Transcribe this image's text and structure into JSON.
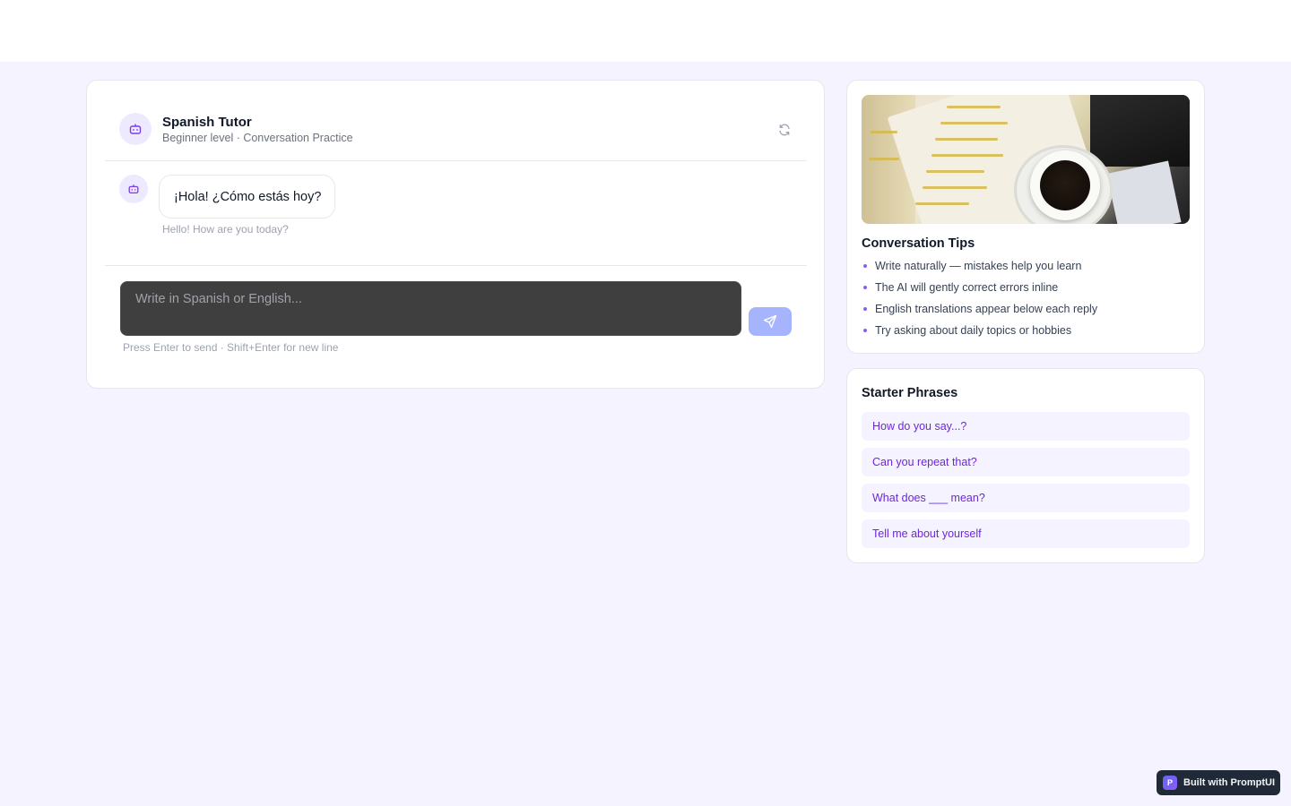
{
  "chat": {
    "tutor_name": "Spanish Tutor",
    "tutor_subtitle": "Beginner level · Conversation Practice",
    "messages": [
      {
        "role": "tutor",
        "text": "¡Hola! ¿Cómo estás hoy?",
        "translation": "Hello! How are you today?"
      }
    ],
    "input": {
      "placeholder": "Write in Spanish or English...",
      "value": ""
    },
    "hint": "Press Enter to send · Shift+Enter for new line"
  },
  "tips": {
    "title": "Conversation Tips",
    "items": [
      "Write naturally — mistakes help you learn",
      "The AI will gently correct errors inline",
      "English translations appear below each reply",
      "Try asking about daily topics or hobbies"
    ]
  },
  "phrases": {
    "title": "Starter Phrases",
    "items": [
      "How do you say...?",
      "Can you repeat that?",
      "What does ___ mean?",
      "Tell me about yourself"
    ]
  },
  "badge": {
    "logo_letter": "P",
    "label": "Built with PromptUI"
  },
  "colors": {
    "accent": "#7c3aed",
    "accent_light": "#ede9fe",
    "send_button": "#a5b4fc",
    "background": "#f5f3ff",
    "input_bg": "#3f3f3f"
  },
  "icons": {
    "tutor_avatar": "robot-icon",
    "refresh": "refresh-icon",
    "send": "send-icon"
  }
}
